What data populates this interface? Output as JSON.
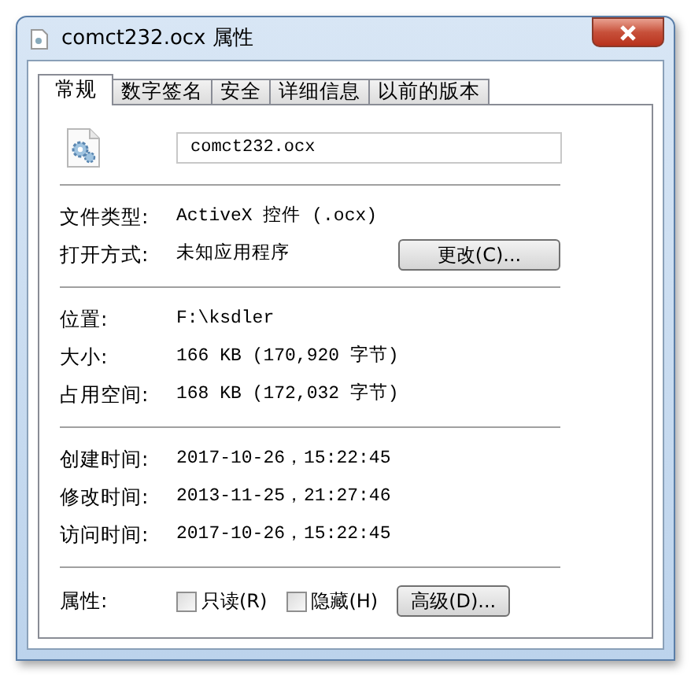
{
  "window": {
    "title": "comct232.ocx 属性"
  },
  "tabs": [
    {
      "label": "常规",
      "selected": true
    },
    {
      "label": "数字签名",
      "selected": false
    },
    {
      "label": "安全",
      "selected": false
    },
    {
      "label": "详细信息",
      "selected": false
    },
    {
      "label": "以前的版本",
      "selected": false
    }
  ],
  "file_name": "comct232.ocx",
  "sections": [
    [
      {
        "label": "文件类型:",
        "value": "ActiveX 控件 (.ocx)"
      },
      {
        "label": "打开方式:",
        "value": "未知应用程序",
        "button": "更改(C)..."
      }
    ],
    [
      {
        "label": "位置:",
        "value": "F:\\ksdler"
      },
      {
        "label": "大小:",
        "value": "166 KB (170,920 字节)"
      },
      {
        "label": "占用空间:",
        "value": "168 KB (172,032 字节)"
      }
    ],
    [
      {
        "label": "创建时间:",
        "value": "2017-10-26，15:22:45"
      },
      {
        "label": "修改时间:",
        "value": "2013-11-25，21:27:46"
      },
      {
        "label": "访问时间:",
        "value": "2017-10-26，15:22:45"
      }
    ]
  ],
  "attributes": {
    "label": "属性:",
    "options": [
      {
        "label": "只读(R)",
        "checked": false
      },
      {
        "label": "隐藏(H)",
        "checked": false
      }
    ],
    "button": "高级(D)..."
  }
}
